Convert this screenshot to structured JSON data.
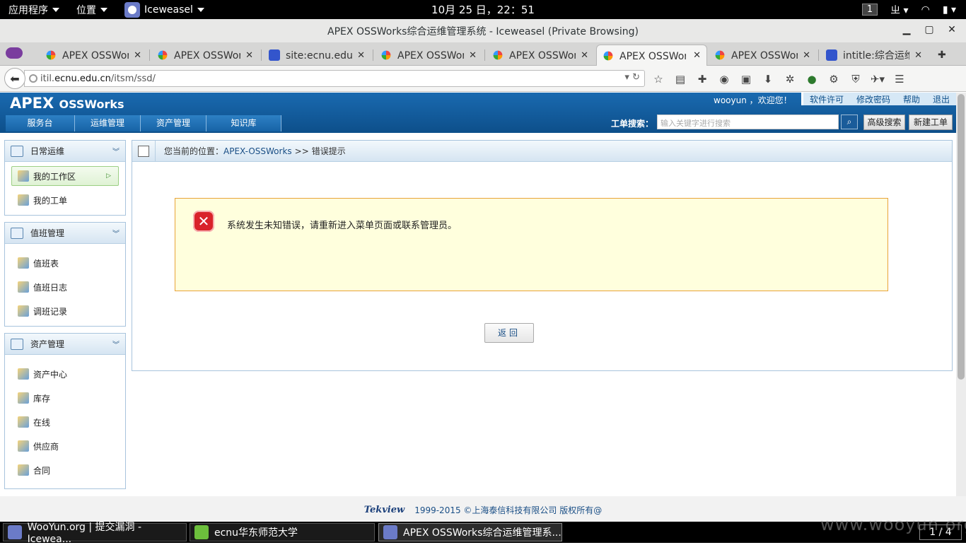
{
  "desktop": {
    "apps_menu": "应用程序",
    "places_menu": "位置",
    "active_app": "Iceweasel",
    "clock": "10月 25 日，22：51",
    "workspace": "1",
    "input_method": "ㄓ"
  },
  "window": {
    "title": "APEX OSSWorks综合运维管理系统 - Iceweasel (Private Browsing)"
  },
  "tabs": [
    {
      "label": "APEX OSSWorks综合运维管理系统",
      "icon": "apex-favicon"
    },
    {
      "label": "APEX OSSWorks综合运维管理系统",
      "icon": "apex-favicon"
    },
    {
      "label": "site:ecnu.edu.cn_百度搜索",
      "icon": "paw-favicon"
    },
    {
      "label": "APEX OSSWorks综合运维管理系统",
      "icon": "apex-favicon"
    },
    {
      "label": "APEX OSSWorks综合运维管理系统",
      "icon": "apex-favicon"
    },
    {
      "label": "APEX OSSWorks综合运维管理系统",
      "icon": "apex-favicon"
    },
    {
      "label": "APEX OSSWorks综合运维管理系统",
      "icon": "apex-favicon"
    },
    {
      "label": "intitle:综合运维管理系统",
      "icon": "paw-favicon"
    }
  ],
  "urlbar": {
    "prefix": "itil.",
    "domain": "ecnu.edu.cn",
    "path": "/itsm/ssd/"
  },
  "app": {
    "brand_main": "APEX",
    "brand_sub": "OSSWorks",
    "user_greeting": "wooyun ，欢迎您！",
    "user_links": [
      "软件许可",
      "修改密码",
      "帮助",
      "退出"
    ],
    "main_tabs": [
      "服务台",
      "运维管理",
      "资产管理",
      "知识库"
    ],
    "search_label": "工单搜索：",
    "search_placeholder": "输入关键字进行搜索",
    "advanced_search": "高级搜索",
    "new_ticket": "新建工单"
  },
  "sidebar": {
    "panels": [
      {
        "title": "日常运维",
        "items": [
          "我的工作区",
          "我的工单"
        ]
      },
      {
        "title": "值班管理",
        "items": [
          "值班表",
          "值班日志",
          "调班记录"
        ]
      },
      {
        "title": "资产管理",
        "items": [
          "资产中心",
          "库存",
          "在线",
          "供应商",
          "合同"
        ]
      }
    ]
  },
  "content": {
    "breadcrumb_prefix": "您当前的位置：",
    "breadcrumb_link": "APEX-OSSWorks",
    "breadcrumb_sep": ">>",
    "breadcrumb_current": "错误提示",
    "error_message": "系统发生未知错误，请重新进入菜单页面或联系管理员。",
    "back_button": "返回"
  },
  "footer": {
    "logo": "Tekview",
    "copyright": "1999-2015 ©上海泰信科技有限公司 版权所有@"
  },
  "taskbar": {
    "tasks": [
      "WooYun.org | 提交漏洞 - Icewea...",
      "ecnu华东师范大学",
      "APEX OSSWorks综合运维管理系..."
    ],
    "pager": "1 / 4"
  },
  "watermark": "www.wooyun.org"
}
